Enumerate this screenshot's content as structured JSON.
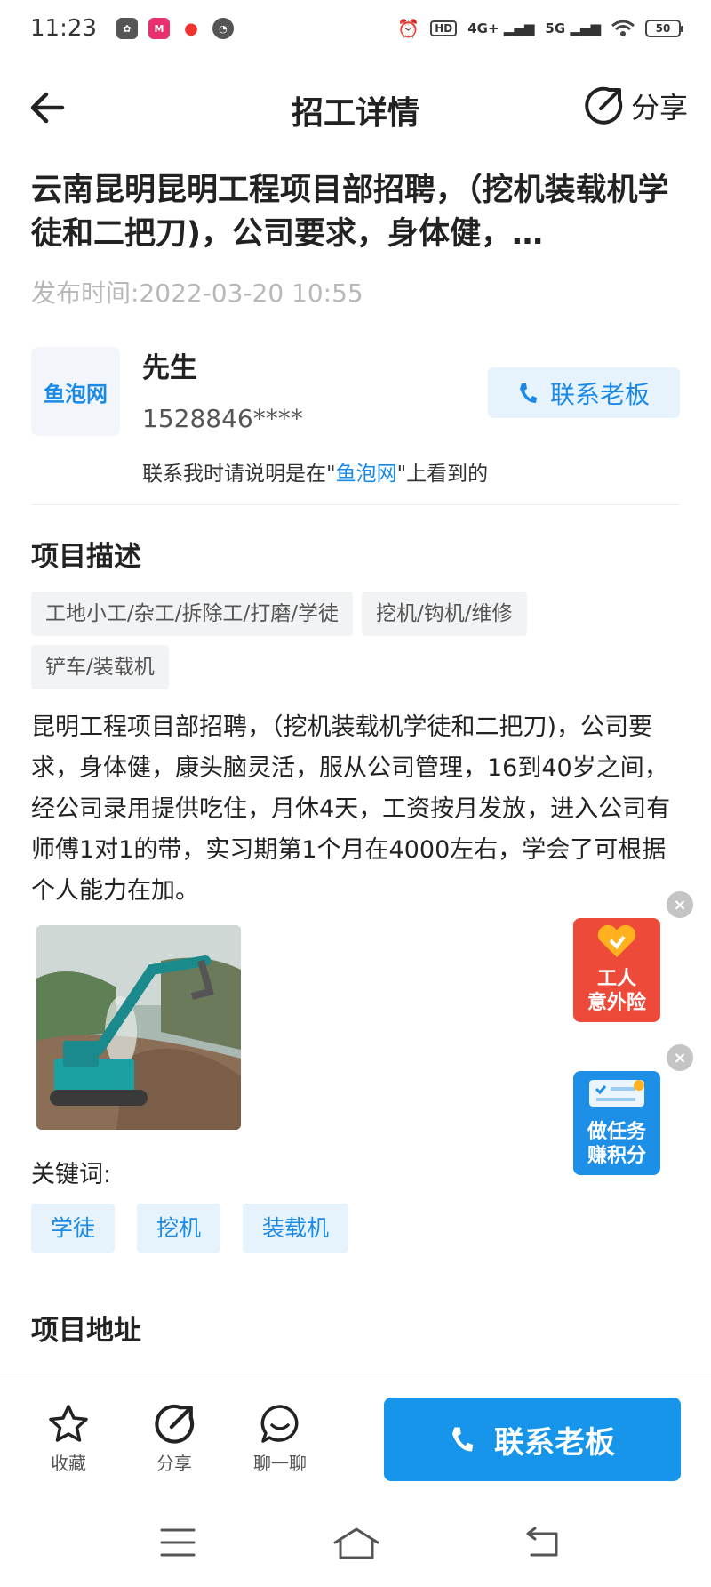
{
  "status_bar": {
    "time": "11:23",
    "signal_4g": "4G+",
    "signal_5g": "5G",
    "hd": "HD",
    "battery": "50"
  },
  "nav": {
    "title": "招工详情",
    "share_label": "分享"
  },
  "job": {
    "title": "云南昆明昆明工程项目部招聘，（挖机装载机学徒和二把刀)，公司要求，身体健，…",
    "publish_time": "发布时间:2022-03-20 10:55"
  },
  "contact": {
    "logo_text": "鱼泡网",
    "name": "先生",
    "phone": "1528846****",
    "note_prefix": "联系我时请说明是在\"",
    "note_highlight": "鱼泡网",
    "note_suffix": "\"上看到的",
    "button_label": "联系老板"
  },
  "project": {
    "section_title": "项目描述",
    "tags": [
      "工地小工/杂工/拆除工/打磨/学徒",
      "挖机/钩机/维修",
      "铲车/装载机"
    ],
    "description": "昆明工程项目部招聘，（挖机装载机学徒和二把刀)，公司要求，身体健，康头脑灵活，服从公司管理，16到40岁之间，经公司录用提供吃住，月休4天，工资按月发放，进入公司有师傅1对1的带，实习期第1个月在4000左右，学会了可根据个人能力在加。",
    "keywords_label": "关键词:",
    "keywords": [
      "学徒",
      "挖机",
      "装载机"
    ],
    "address_title": "项目地址"
  },
  "floating": {
    "insurance": [
      "工人",
      "意外险"
    ],
    "task": [
      "做任务",
      "赚积分"
    ],
    "close_glyph": "×"
  },
  "bottom_bar": {
    "favorite_label": "收藏",
    "share_label": "分享",
    "chat_label": "聊一聊",
    "contact_label": "联系老板"
  },
  "colors": {
    "accent": "#1795ea",
    "accent_light": "#e6f3fd",
    "insurance_red": "#ee4a3a"
  }
}
